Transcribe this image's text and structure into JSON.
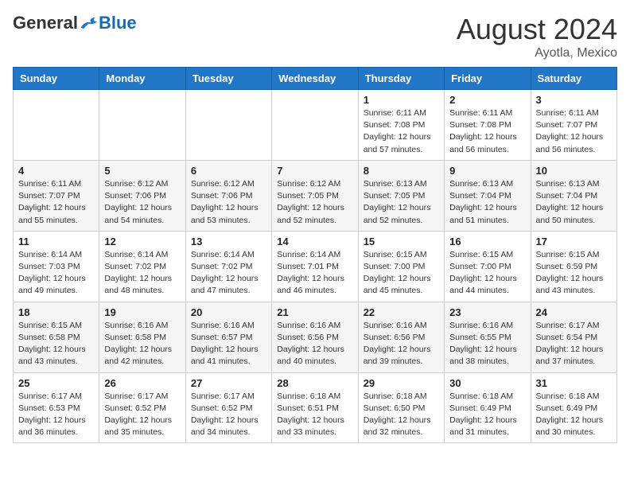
{
  "header": {
    "logo_general": "General",
    "logo_blue": "Blue",
    "month_year": "August 2024",
    "location": "Ayotla, Mexico"
  },
  "days_of_week": [
    "Sunday",
    "Monday",
    "Tuesday",
    "Wednesday",
    "Thursday",
    "Friday",
    "Saturday"
  ],
  "weeks": [
    [
      {
        "day": "",
        "info": ""
      },
      {
        "day": "",
        "info": ""
      },
      {
        "day": "",
        "info": ""
      },
      {
        "day": "",
        "info": ""
      },
      {
        "day": "1",
        "info": "Sunrise: 6:11 AM\nSunset: 7:08 PM\nDaylight: 12 hours\nand 57 minutes."
      },
      {
        "day": "2",
        "info": "Sunrise: 6:11 AM\nSunset: 7:08 PM\nDaylight: 12 hours\nand 56 minutes."
      },
      {
        "day": "3",
        "info": "Sunrise: 6:11 AM\nSunset: 7:07 PM\nDaylight: 12 hours\nand 56 minutes."
      }
    ],
    [
      {
        "day": "4",
        "info": "Sunrise: 6:11 AM\nSunset: 7:07 PM\nDaylight: 12 hours\nand 55 minutes."
      },
      {
        "day": "5",
        "info": "Sunrise: 6:12 AM\nSunset: 7:06 PM\nDaylight: 12 hours\nand 54 minutes."
      },
      {
        "day": "6",
        "info": "Sunrise: 6:12 AM\nSunset: 7:06 PM\nDaylight: 12 hours\nand 53 minutes."
      },
      {
        "day": "7",
        "info": "Sunrise: 6:12 AM\nSunset: 7:05 PM\nDaylight: 12 hours\nand 52 minutes."
      },
      {
        "day": "8",
        "info": "Sunrise: 6:13 AM\nSunset: 7:05 PM\nDaylight: 12 hours\nand 52 minutes."
      },
      {
        "day": "9",
        "info": "Sunrise: 6:13 AM\nSunset: 7:04 PM\nDaylight: 12 hours\nand 51 minutes."
      },
      {
        "day": "10",
        "info": "Sunrise: 6:13 AM\nSunset: 7:04 PM\nDaylight: 12 hours\nand 50 minutes."
      }
    ],
    [
      {
        "day": "11",
        "info": "Sunrise: 6:14 AM\nSunset: 7:03 PM\nDaylight: 12 hours\nand 49 minutes."
      },
      {
        "day": "12",
        "info": "Sunrise: 6:14 AM\nSunset: 7:02 PM\nDaylight: 12 hours\nand 48 minutes."
      },
      {
        "day": "13",
        "info": "Sunrise: 6:14 AM\nSunset: 7:02 PM\nDaylight: 12 hours\nand 47 minutes."
      },
      {
        "day": "14",
        "info": "Sunrise: 6:14 AM\nSunset: 7:01 PM\nDaylight: 12 hours\nand 46 minutes."
      },
      {
        "day": "15",
        "info": "Sunrise: 6:15 AM\nSunset: 7:00 PM\nDaylight: 12 hours\nand 45 minutes."
      },
      {
        "day": "16",
        "info": "Sunrise: 6:15 AM\nSunset: 7:00 PM\nDaylight: 12 hours\nand 44 minutes."
      },
      {
        "day": "17",
        "info": "Sunrise: 6:15 AM\nSunset: 6:59 PM\nDaylight: 12 hours\nand 43 minutes."
      }
    ],
    [
      {
        "day": "18",
        "info": "Sunrise: 6:15 AM\nSunset: 6:58 PM\nDaylight: 12 hours\nand 43 minutes."
      },
      {
        "day": "19",
        "info": "Sunrise: 6:16 AM\nSunset: 6:58 PM\nDaylight: 12 hours\nand 42 minutes."
      },
      {
        "day": "20",
        "info": "Sunrise: 6:16 AM\nSunset: 6:57 PM\nDaylight: 12 hours\nand 41 minutes."
      },
      {
        "day": "21",
        "info": "Sunrise: 6:16 AM\nSunset: 6:56 PM\nDaylight: 12 hours\nand 40 minutes."
      },
      {
        "day": "22",
        "info": "Sunrise: 6:16 AM\nSunset: 6:56 PM\nDaylight: 12 hours\nand 39 minutes."
      },
      {
        "day": "23",
        "info": "Sunrise: 6:16 AM\nSunset: 6:55 PM\nDaylight: 12 hours\nand 38 minutes."
      },
      {
        "day": "24",
        "info": "Sunrise: 6:17 AM\nSunset: 6:54 PM\nDaylight: 12 hours\nand 37 minutes."
      }
    ],
    [
      {
        "day": "25",
        "info": "Sunrise: 6:17 AM\nSunset: 6:53 PM\nDaylight: 12 hours\nand 36 minutes."
      },
      {
        "day": "26",
        "info": "Sunrise: 6:17 AM\nSunset: 6:52 PM\nDaylight: 12 hours\nand 35 minutes."
      },
      {
        "day": "27",
        "info": "Sunrise: 6:17 AM\nSunset: 6:52 PM\nDaylight: 12 hours\nand 34 minutes."
      },
      {
        "day": "28",
        "info": "Sunrise: 6:18 AM\nSunset: 6:51 PM\nDaylight: 12 hours\nand 33 minutes."
      },
      {
        "day": "29",
        "info": "Sunrise: 6:18 AM\nSunset: 6:50 PM\nDaylight: 12 hours\nand 32 minutes."
      },
      {
        "day": "30",
        "info": "Sunrise: 6:18 AM\nSunset: 6:49 PM\nDaylight: 12 hours\nand 31 minutes."
      },
      {
        "day": "31",
        "info": "Sunrise: 6:18 AM\nSunset: 6:49 PM\nDaylight: 12 hours\nand 30 minutes."
      }
    ]
  ]
}
